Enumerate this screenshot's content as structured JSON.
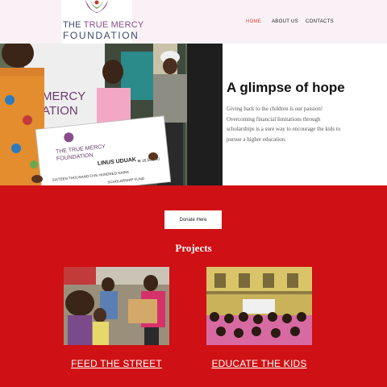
{
  "header": {
    "logo_line1_prefix": "THE ",
    "logo_line1_accent": "TRUE MERCY",
    "logo_line2": "FOUNDATION",
    "nav": [
      {
        "label": "HOME",
        "active": true
      },
      {
        "label": "ABOUT US",
        "active": false
      },
      {
        "label": "CONTACTS",
        "active": false
      }
    ]
  },
  "hero": {
    "title": "A glimpse of hope",
    "body": "Giving back to the children is our passion! Overcoming financial limitations through scholarships is a sure way to encourage the kids to pursue a higher education.",
    "cheque": {
      "org_line1": "THE TRUE MERCY",
      "org_line2": "FOUNDATION",
      "payee": "LINUS UDUAK",
      "amount": "SIXTEEN THOUSAND FIVE HUNDRED NAIRA",
      "figure": "₦ 16,500.00",
      "fund": "SCHOLARSHIP FUND"
    }
  },
  "cta": {
    "donate_label": "Donate Here"
  },
  "projects": {
    "title": "Projects",
    "items": [
      {
        "label": "FEED THE STREET"
      },
      {
        "label": "EDUCATE THE KIDS"
      }
    ]
  },
  "colors": {
    "accent_red": "#cf1014",
    "nav_active": "#e0443a",
    "header_bg": "#f9f1f6",
    "logo_purple": "#8a4d8c",
    "logo_navy": "#3d4a6b"
  }
}
